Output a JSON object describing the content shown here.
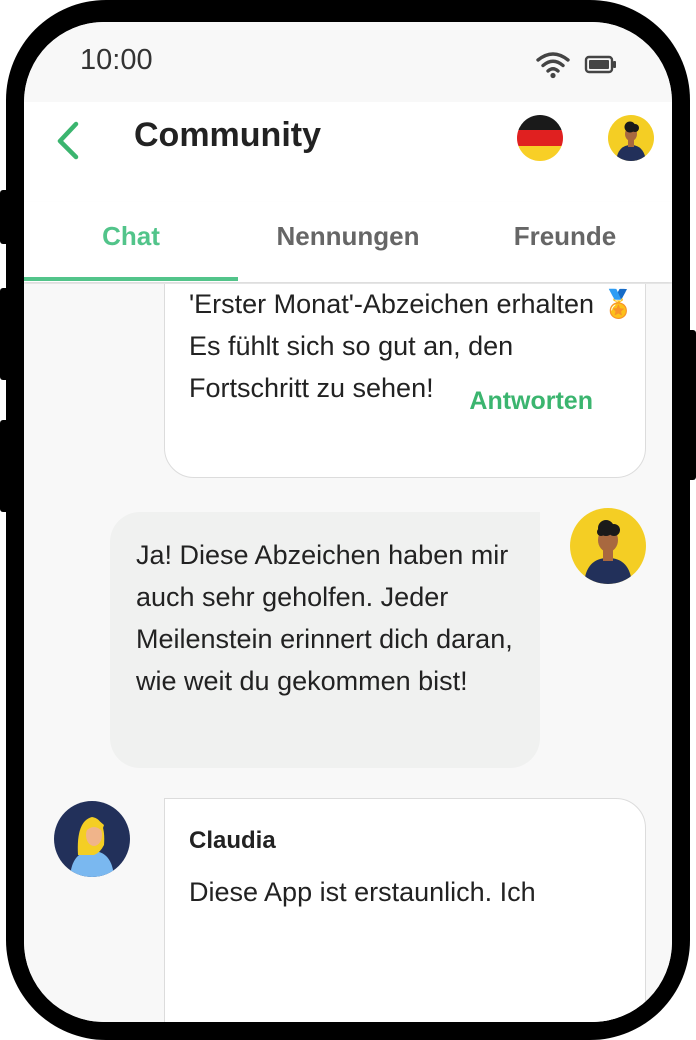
{
  "status_bar": {
    "time": "10:00",
    "icons": [
      "wifi-icon",
      "battery-icon"
    ]
  },
  "header": {
    "title": "Community",
    "back_icon": "chevron-left-icon",
    "language_flag": "germany-flag-icon",
    "profile_icon": "user-avatar-icon"
  },
  "tabs": [
    {
      "label": "Chat",
      "active": true
    },
    {
      "label": "Nennungen",
      "active": false
    },
    {
      "label": "Freunde",
      "active": false
    }
  ],
  "messages": [
    {
      "type": "incoming-card",
      "text": "'Erster Monat'-Abzeichen erhalten 🏅 Es fühlt sich so gut an, den Fortschritt zu sehen!",
      "reply_label": "Antworten"
    },
    {
      "type": "own",
      "text": "Ja! Diese Abzeichen haben mir auch sehr geholfen. Jeder Meilenstein erinnert dich daran, wie weit du gekommen bist!"
    },
    {
      "type": "incoming-card",
      "sender": "Claudia",
      "text": "Diese App ist erstaunlich. Ich"
    }
  ],
  "colors": {
    "accent": "#52c48a",
    "reply": "#3bb56f",
    "avatar_yellow": "#f4ce24",
    "avatar_navy": "#22305a",
    "own_bubble": "#f0f1f0"
  }
}
